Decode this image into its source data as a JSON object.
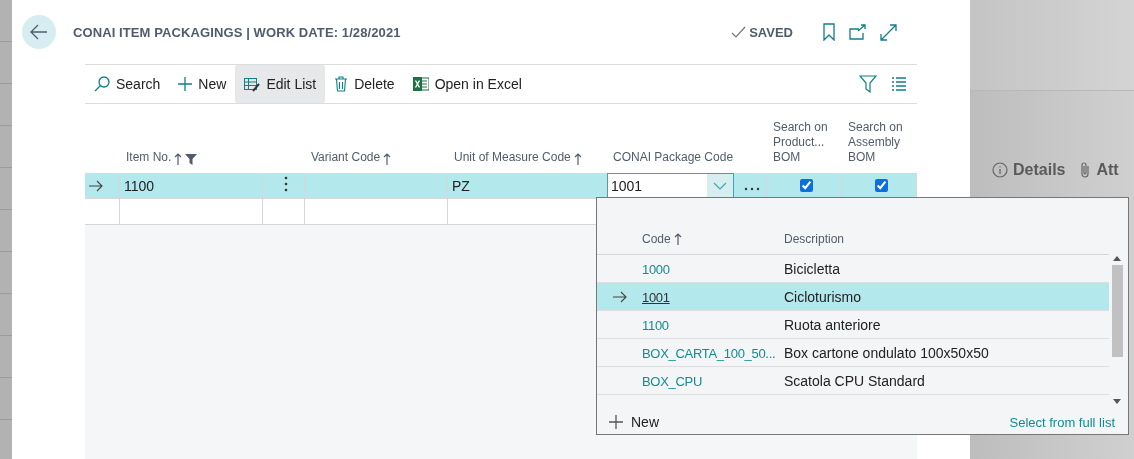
{
  "page": {
    "title": "CONAI ITEM PACKAGINGS | WORK DATE: 1/28/2021",
    "status": "SAVED"
  },
  "toolbar": {
    "actions": [
      {
        "label": "Search",
        "selected": false
      },
      {
        "label": "New",
        "selected": false
      },
      {
        "label": "Edit List",
        "selected": true
      },
      {
        "label": "Delete",
        "selected": false
      },
      {
        "label": "Open in Excel",
        "selected": false
      }
    ]
  },
  "table": {
    "columns": [
      {
        "label": "Item No.",
        "sorted": true,
        "filtered": true
      },
      {
        "label": "Variant Code",
        "sorted": true,
        "filtered": false
      },
      {
        "label": "Unit of Measure Code",
        "sorted": true,
        "filtered": false
      },
      {
        "label": "CONAI Package Code",
        "sorted": false,
        "filtered": false
      },
      {
        "label": "Search on Product... BOM",
        "sorted": false,
        "filtered": false
      },
      {
        "label": "Search on Assembly BOM",
        "sorted": false,
        "filtered": false
      }
    ],
    "rows": [
      {
        "selected": true,
        "item_no": "1100",
        "unit_of_measure": "PZ",
        "package_code": "1001",
        "product_bom": true,
        "assembly_bom": true
      },
      {
        "selected": false
      }
    ]
  },
  "lookup": {
    "columns": [
      {
        "label": "Code",
        "sorted": true
      },
      {
        "label": "Description",
        "sorted": false
      }
    ],
    "rows": [
      {
        "code": "1000",
        "description": "Bicicletta",
        "selected": false
      },
      {
        "code": "1001",
        "description": "Cicloturismo",
        "selected": true
      },
      {
        "code": "1100",
        "description": "Ruota anteriore",
        "selected": false
      },
      {
        "code": "BOX_CARTA_100_50...",
        "description": "Box cartone ondulato 100x50x50",
        "selected": false
      },
      {
        "code": "BOX_CPU",
        "description": "Scatola CPU Standard",
        "selected": false
      }
    ],
    "new_label": "New",
    "full_list_link": "Select from full list"
  },
  "side_panel": {
    "tabs": [
      {
        "label": "Details"
      },
      {
        "label": "Att"
      }
    ]
  }
}
